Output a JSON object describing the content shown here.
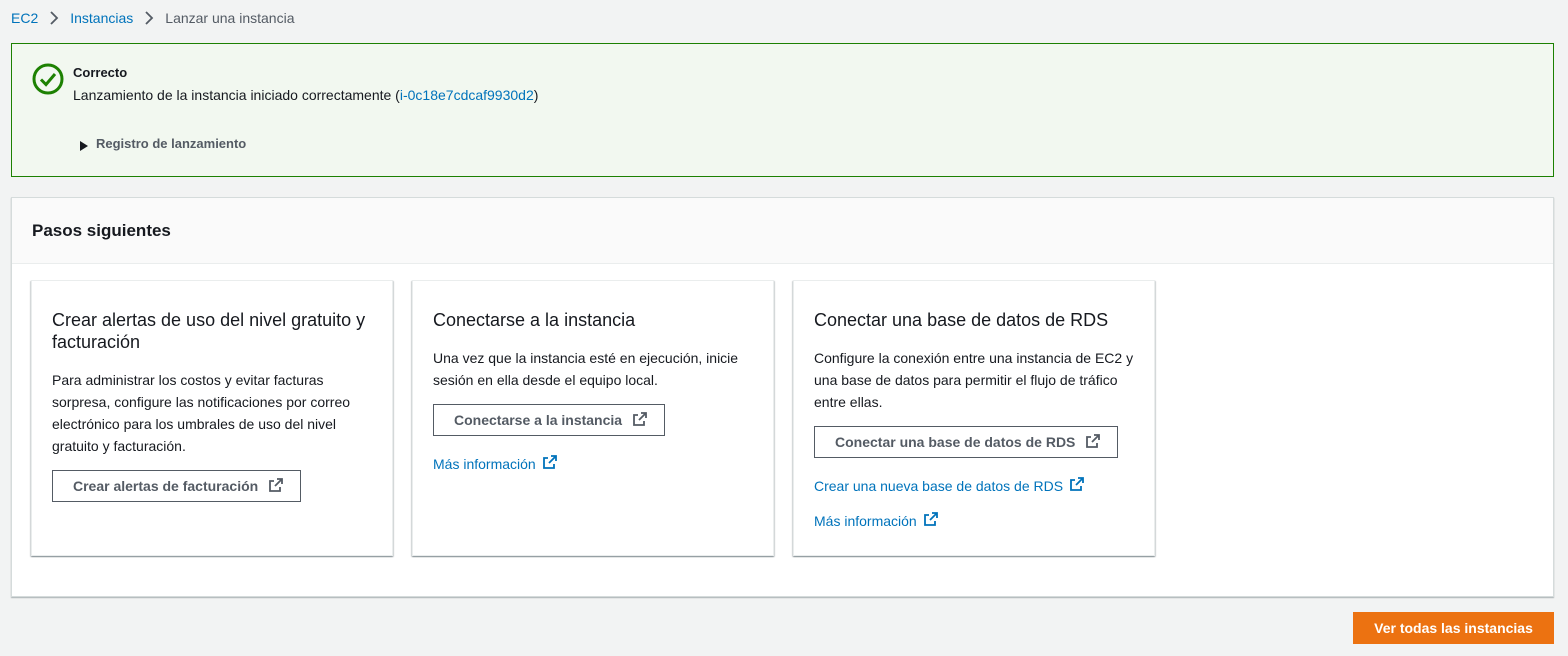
{
  "breadcrumb": {
    "items": [
      "EC2",
      "Instancias"
    ],
    "current": "Lanzar una instancia"
  },
  "flash": {
    "title": "Correcto",
    "message_prefix": "Lanzamiento de la instancia iniciado correctamente (",
    "instance_id": "i-0c18e7cdcaf9930d2",
    "message_suffix": ")",
    "log_label": "Registro de lanzamiento",
    "status_color": "#1d8102"
  },
  "next_steps": {
    "title": "Pasos siguientes",
    "cards": [
      {
        "title": "Crear alertas de uso del nivel gratuito y facturación",
        "description": "Para administrar los costos y evitar facturas sorpresa, configure las notificaciones por correo electrónico para los umbrales de uso del nivel gratuito y facturación.",
        "button": "Crear alertas de facturación"
      },
      {
        "title": "Conectarse a la instancia",
        "description": "Una vez que la instancia esté en ejecución, inicie sesión en ella desde el equipo local.",
        "button": "Conectarse a la instancia",
        "link": "Más información"
      },
      {
        "title": "Conectar una base de datos de RDS",
        "description": "Configure la conexión entre una instancia de EC2 y una base de datos para permitir el flujo de tráfico entre ellas.",
        "button": "Conectar una base de datos de RDS",
        "link_create": "Crear una nueva base de datos de RDS",
        "link": "Más información"
      }
    ]
  },
  "footer": {
    "primary_button": "Ver todas las instancias",
    "accent_color": "#ec7211"
  },
  "icons": {
    "success": "check-circle-icon",
    "external": "external-link-icon",
    "breadcrumb_sep": "chevron-right-icon",
    "expand": "caret-right-icon"
  }
}
